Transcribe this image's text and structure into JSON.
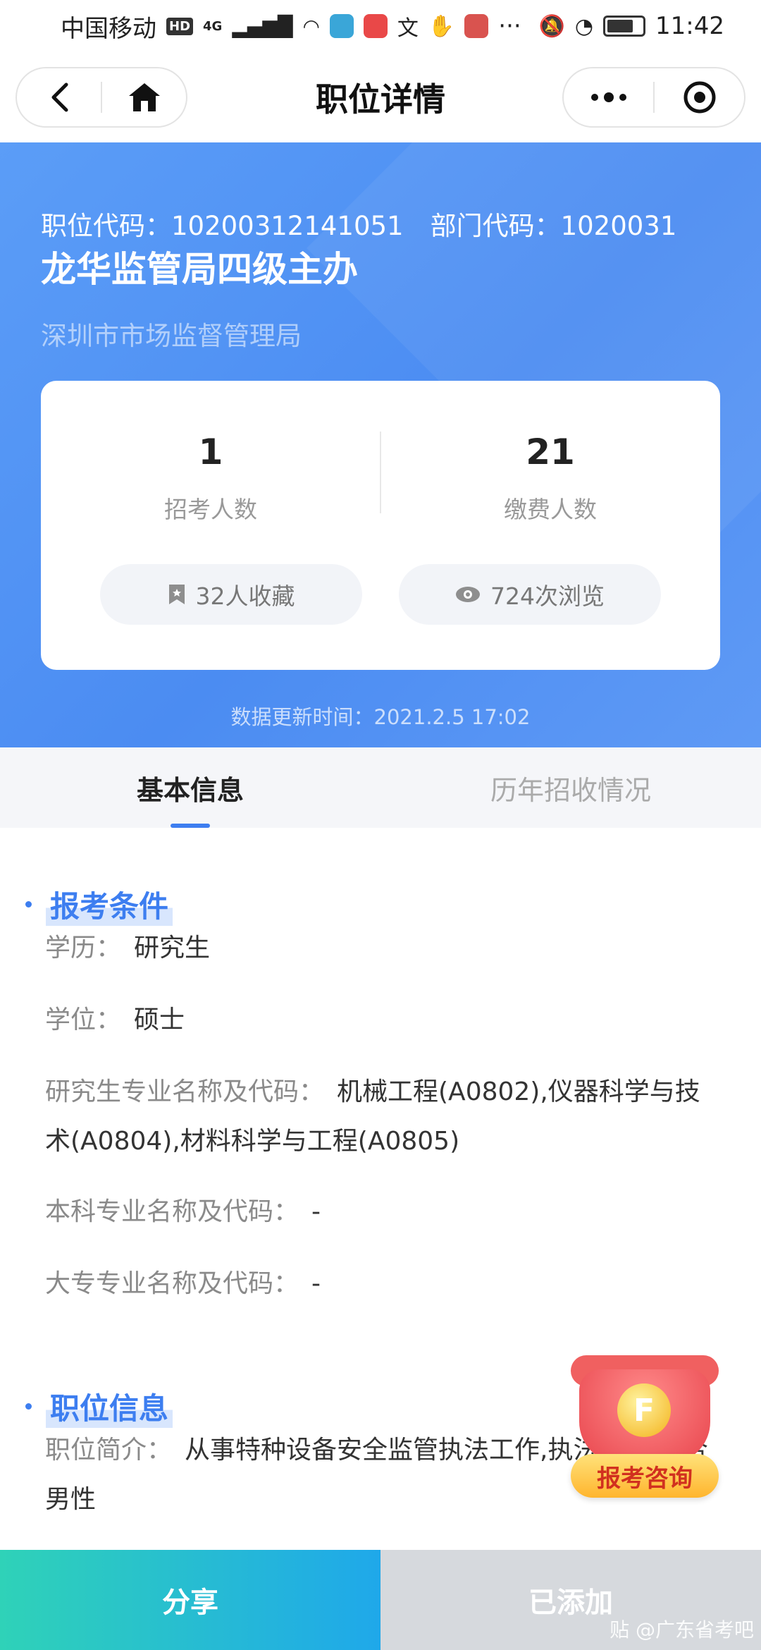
{
  "status_bar": {
    "carrier": "中国移动",
    "hd_tag": "HD",
    "network": "4G",
    "app_icon_colors": [
      "#3aa6d8",
      "#e94848",
      "#333333",
      "#d9534f"
    ],
    "time": "11:42"
  },
  "nav": {
    "title": "职位详情"
  },
  "job": {
    "position_code_label": "职位代码：",
    "position_code": "10200312141051",
    "dept_code_label": "部门代码：",
    "dept_code": "1020031",
    "title": "龙华监管局四级主办",
    "department": "深圳市市场监督管理局"
  },
  "stats": {
    "recruit_count": "1",
    "recruit_label": "招考人数",
    "paid_count": "21",
    "paid_label": "缴费人数",
    "favorites": "32人收藏",
    "views": "724次浏览"
  },
  "update_time": "数据更新时间：2021.2.5 17:02",
  "tabs": [
    {
      "label": "基本信息",
      "active": true
    },
    {
      "label": "历年招收情况",
      "active": false
    }
  ],
  "requirements": {
    "heading": "报考条件",
    "rows": [
      {
        "key": "学历：",
        "value": "研究生"
      },
      {
        "key": "学位：",
        "value": "硕士"
      },
      {
        "key": "研究生专业名称及代码：",
        "value": "机械工程(A0802),仪器科学与技术(A0804),材料科学与工程(A0805)"
      },
      {
        "key": "本科专业名称及代码：",
        "value": "-"
      },
      {
        "key": "大专专业名称及代码：",
        "value": "-"
      }
    ]
  },
  "position_info": {
    "heading": "职位信息",
    "rows": [
      {
        "key": "职位简介：",
        "value": "从事特种设备安全监管执法工作,执法岗位,适合男性"
      }
    ]
  },
  "float_button": {
    "label": "报考咨询",
    "coin_letter": "F"
  },
  "bottom_bar": {
    "share_label": "分享",
    "added_label": "已添加"
  },
  "watermark": "贴 @广东省考吧",
  "colors": {
    "accent": "#3d7ef0",
    "header_gradient_start": "#5b9df7",
    "share_gradient_start": "#2fd2b8",
    "share_gradient_end": "#1fa8ea"
  }
}
